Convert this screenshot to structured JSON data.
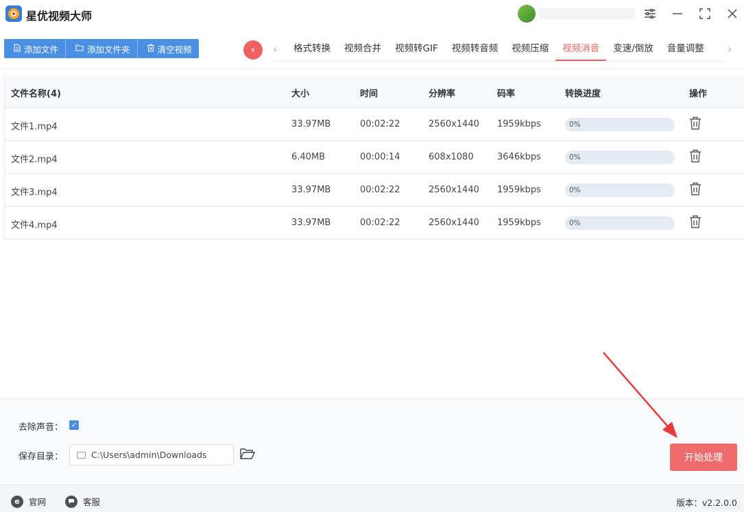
{
  "app": {
    "title": "星优视频大师"
  },
  "toolbar": {
    "add_file": "添加文件",
    "add_folder": "添加文件夹",
    "clear_videos": "清空视频"
  },
  "tabs": [
    {
      "label": "格式转换",
      "active": false
    },
    {
      "label": "视频合并",
      "active": false
    },
    {
      "label": "视频转GIF",
      "active": false
    },
    {
      "label": "视频转音频",
      "active": false
    },
    {
      "label": "视频压缩",
      "active": false
    },
    {
      "label": "视频消音",
      "active": true
    },
    {
      "label": "变速/倒放",
      "active": false
    },
    {
      "label": "音量调整",
      "active": false
    }
  ],
  "table": {
    "headers": {
      "name": "文件名称(4)",
      "size": "大小",
      "duration": "时间",
      "resolution": "分辨率",
      "bitrate": "码率",
      "progress": "转换进度",
      "action": "操作"
    },
    "rows": [
      {
        "name": "文件1.mp4",
        "size": "33.97MB",
        "duration": "00:02:22",
        "resolution": "2560x1440",
        "bitrate": "1959kbps",
        "progress": "0%"
      },
      {
        "name": "文件2.mp4",
        "size": "6.40MB",
        "duration": "00:00:14",
        "resolution": "608x1080",
        "bitrate": "3646kbps",
        "progress": "0%"
      },
      {
        "name": "文件3.mp4",
        "size": "33.97MB",
        "duration": "00:02:22",
        "resolution": "2560x1440",
        "bitrate": "1959kbps",
        "progress": "0%"
      },
      {
        "name": "文件4.mp4",
        "size": "33.97MB",
        "duration": "00:02:22",
        "resolution": "2560x1440",
        "bitrate": "1959kbps",
        "progress": "0%"
      }
    ]
  },
  "options": {
    "remove_audio_label": "去除声音：",
    "remove_audio_checked": true,
    "save_dir_label": "保存目录：",
    "save_dir_value": "C:\\Users\\admin\\Downloads"
  },
  "start_button": "开始处理",
  "footer": {
    "website": "官网",
    "support": "客服",
    "version": "版本：v2.2.0.0"
  },
  "colors": {
    "accent_blue": "#4a90e2",
    "accent_red": "#f06b6b",
    "annotation_red": "#e83a3a"
  },
  "icons": {
    "minimize": "minimize-icon",
    "maximize": "maximize-icon",
    "close": "close-icon",
    "settings": "sliders-icon",
    "trash": "trash-icon",
    "folder": "folder-icon",
    "back": "chevron-left-icon"
  }
}
